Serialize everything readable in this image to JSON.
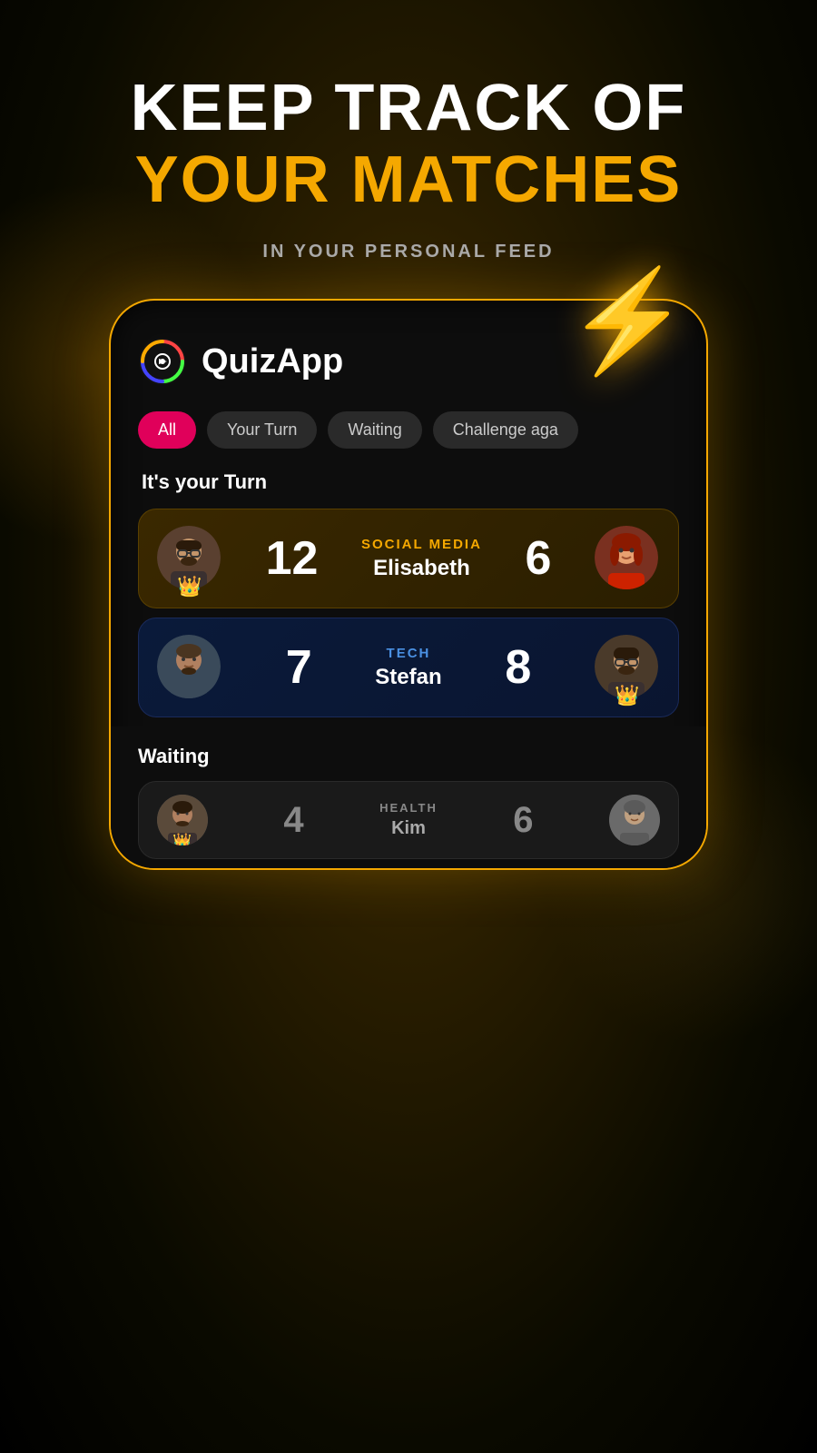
{
  "headline": {
    "line1": "KEEP TRACK OF",
    "line2": "YOUR MATCHES",
    "subtitle": "IN YOUR PERSONAL FEED"
  },
  "app": {
    "name": "QuizApp"
  },
  "filters": [
    {
      "label": "All",
      "active": true
    },
    {
      "label": "Your Turn",
      "active": false
    },
    {
      "label": "Waiting",
      "active": false
    },
    {
      "label": "Challenge aga",
      "active": false
    }
  ],
  "your_turn_label": "It's your Turn",
  "matches_your_turn": [
    {
      "category": "SOCIAL MEDIA",
      "category_color": "gold",
      "opponent": "Elisabeth",
      "my_score": "12",
      "opponent_score": "6",
      "my_crown": true,
      "opponent_crown": false,
      "theme": "gold"
    },
    {
      "category": "TECH",
      "category_color": "blue",
      "opponent": "Stefan",
      "my_score": "7",
      "opponent_score": "8",
      "my_crown": false,
      "opponent_crown": true,
      "theme": "blue"
    }
  ],
  "waiting_label": "Waiting",
  "matches_waiting": [
    {
      "category": "HEALTH",
      "opponent": "Kim",
      "my_score": "4",
      "opponent_score": "6"
    }
  ],
  "lightning_icon": "⚡"
}
